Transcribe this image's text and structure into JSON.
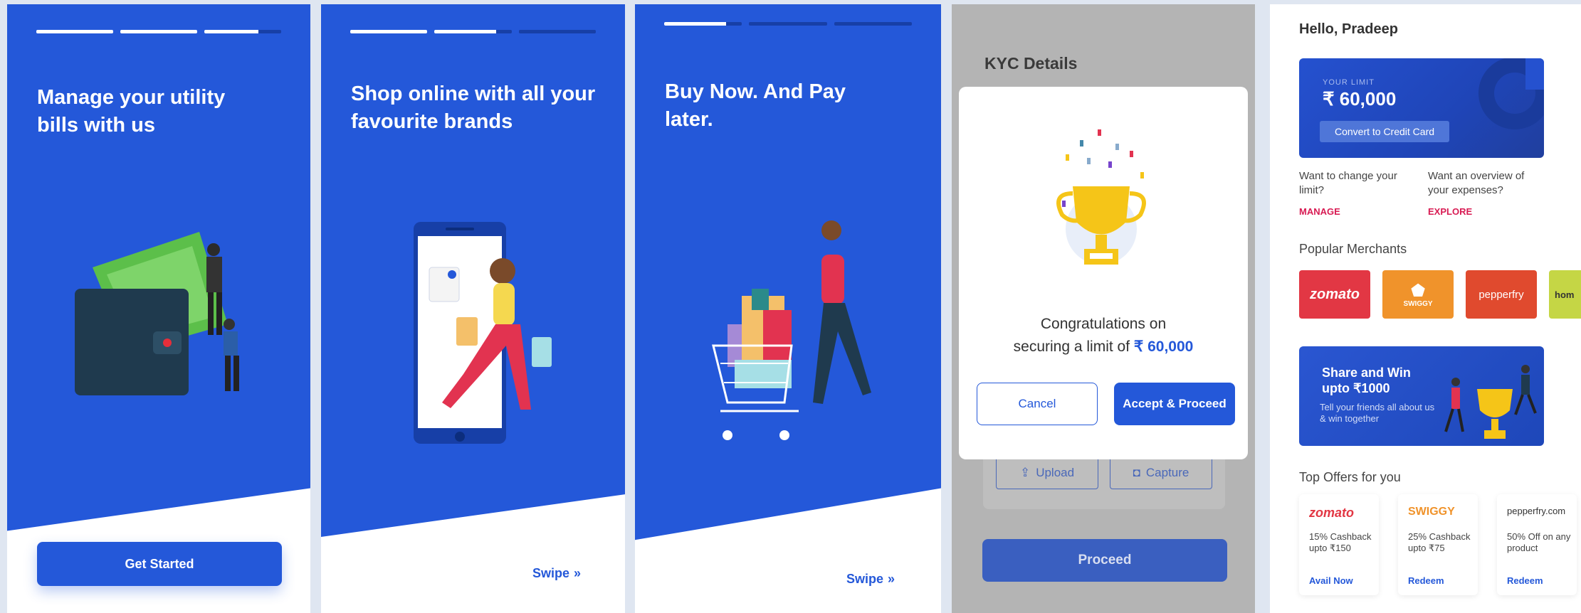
{
  "onboarding": [
    {
      "headline": "Manage your utility bills with us",
      "cta": "Get Started",
      "progress": [
        1,
        1,
        0.7
      ]
    },
    {
      "headline": "Shop online with all your favourite brands",
      "swipe": "Swipe",
      "progress": [
        1,
        0.8,
        0
      ]
    },
    {
      "headline": "Buy Now. And Pay later.",
      "swipe": "Swipe",
      "progress": [
        0.8,
        0,
        0
      ]
    }
  ],
  "kyc": {
    "title": "KYC Details",
    "upload": "Upload",
    "capture": "Capture",
    "proceed": "Proceed",
    "modal": {
      "line1": "Congratulations on",
      "line2": "securing a limit of",
      "amount": "₹ 60,000",
      "cancel": "Cancel",
      "accept": "Accept & Proceed"
    }
  },
  "home": {
    "greeting": "Hello, Pradeep",
    "limit": {
      "label": "YOUR LIMIT",
      "amount": "₹ 60,000",
      "button": "Convert to Credit Card"
    },
    "manage": {
      "text": "Want to change your limit?",
      "link": "MANAGE"
    },
    "explore": {
      "text": "Want an overview of your expenses?",
      "link": "EXPLORE"
    },
    "popular_title": "Popular Merchants",
    "merchants": [
      {
        "name": "zomato",
        "color": "#e23744"
      },
      {
        "name": "SWIGGY",
        "color": "#f0932b"
      },
      {
        "name": "pepperfry",
        "color": "#e04a2e"
      },
      {
        "name": "hom",
        "color": "#c5d645"
      }
    ],
    "share": {
      "title": "Share and Win upto ₹1000",
      "sub": "Tell your friends all about us & win together"
    },
    "offers_title": "Top Offers for you",
    "offers": [
      {
        "brand": "zomato",
        "color": "#e23744",
        "desc": "15% Cashback upto ₹150",
        "link": "Avail Now"
      },
      {
        "brand": "SWIGGY",
        "color": "#f0932b",
        "desc": "25% Cashback upto ₹75",
        "link": "Redeem"
      },
      {
        "brand": "pepperfry.com",
        "color": "#333333",
        "desc": "50% Off on any product",
        "link": "Redeem"
      }
    ]
  },
  "colors": {
    "primary": "#2458d9",
    "accent_pink": "#d81b53"
  }
}
